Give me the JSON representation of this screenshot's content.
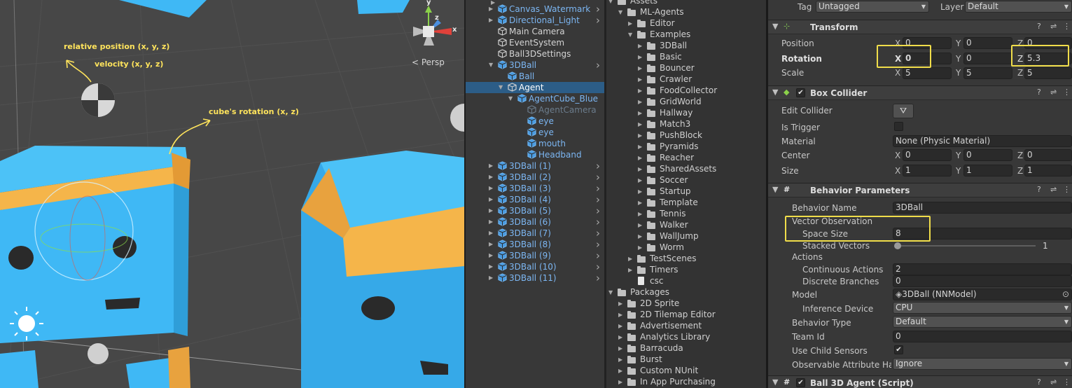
{
  "scene": {
    "annotations": {
      "relative_position": "relative position (x, y, z)",
      "velocity": "velocity (x, y, z)",
      "cube_rotation": "cube's rotation (x, z)"
    },
    "gizmo": {
      "y": "y",
      "z": "z",
      "x": "x"
    },
    "projection_label": "< Persp",
    "annotation_color": "#ffe45c",
    "cube_color": "#3fb8f5",
    "headband_color": "#f5b54a"
  },
  "hierarchy": {
    "items": [
      {
        "label": "Canvas_Watermark",
        "style": "blue"
      },
      {
        "label": "Directional_Light",
        "style": "blue"
      },
      {
        "label": "Main Camera",
        "style": "normal"
      },
      {
        "label": "EventSystem",
        "style": "normal"
      },
      {
        "label": "Ball3DSettings",
        "style": "normal"
      },
      {
        "label": "3DBall",
        "style": "blue"
      },
      {
        "label": "Ball",
        "style": "blue"
      },
      {
        "label": "Agent",
        "style": "normal"
      },
      {
        "label": "AgentCube_Blue",
        "style": "blue"
      },
      {
        "label": "AgentCamera",
        "style": "grey"
      },
      {
        "label": "eye",
        "style": "blue"
      },
      {
        "label": "eye",
        "style": "blue"
      },
      {
        "label": "mouth",
        "style": "blue"
      },
      {
        "label": "Headband",
        "style": "blue"
      },
      {
        "label": "3DBall (1)",
        "style": "blue"
      },
      {
        "label": "3DBall (2)",
        "style": "blue"
      },
      {
        "label": "3DBall (3)",
        "style": "blue"
      },
      {
        "label": "3DBall (4)",
        "style": "blue"
      },
      {
        "label": "3DBall (5)",
        "style": "blue"
      },
      {
        "label": "3DBall (6)",
        "style": "blue"
      },
      {
        "label": "3DBall (7)",
        "style": "blue"
      },
      {
        "label": "3DBall (8)",
        "style": "blue"
      },
      {
        "label": "3DBall (9)",
        "style": "blue"
      },
      {
        "label": "3DBall (10)",
        "style": "blue"
      },
      {
        "label": "3DBall (11)",
        "style": "blue"
      }
    ],
    "selected": "Agent"
  },
  "project": {
    "assets_label": "Assets",
    "ml_agents": "ML-Agents",
    "editor": "Editor",
    "examples": "Examples",
    "example_folders": [
      "3DBall",
      "Basic",
      "Bouncer",
      "Crawler",
      "FoodCollector",
      "GridWorld",
      "Hallway",
      "Match3",
      "PushBlock",
      "Pyramids",
      "Reacher",
      "SharedAssets",
      "Soccer",
      "Startup",
      "Template",
      "Tennis",
      "Walker",
      "WallJump",
      "Worm"
    ],
    "test_scenes": "TestScenes",
    "timers": "Timers",
    "csc": "csc",
    "packages_label": "Packages",
    "packages": [
      "2D Sprite",
      "2D Tilemap Editor",
      "Advertisement",
      "Analytics Library",
      "Barracuda",
      "Burst",
      "Custom NUnit",
      "In App Purchasing"
    ]
  },
  "inspector": {
    "tag_label": "Tag",
    "tag_value": "Untagged",
    "layer_label": "Layer",
    "layer_value": "Default",
    "transform": {
      "title": "Transform",
      "position": {
        "label": "Position",
        "x": "0",
        "y": "0",
        "z": "0"
      },
      "rotation": {
        "label": "Rotation",
        "x": "0",
        "y": "0",
        "z": "5.3"
      },
      "scale": {
        "label": "Scale",
        "x": "5",
        "y": "5",
        "z": "5"
      }
    },
    "box_collider": {
      "title": "Box Collider",
      "edit_collider": "Edit Collider",
      "is_trigger": "Is Trigger",
      "material_label": "Material",
      "material_value": "None (Physic Material)",
      "center": {
        "label": "Center",
        "x": "0",
        "y": "0",
        "z": "0"
      },
      "size": {
        "label": "Size",
        "x": "1",
        "y": "1",
        "z": "1"
      }
    },
    "behavior": {
      "title": "Behavior Parameters",
      "behavior_name_label": "Behavior Name",
      "behavior_name_value": "3DBall",
      "vector_observation": "Vector Observation",
      "space_size_label": "Space Size",
      "space_size_value": "8",
      "stacked_vectors_label": "Stacked Vectors",
      "stacked_vectors_value": "1",
      "actions": "Actions",
      "continuous_label": "Continuous Actions",
      "continuous_value": "2",
      "discrete_label": "Discrete Branches",
      "discrete_value": "0",
      "model_label": "Model",
      "model_value": "3DBall (NNModel)",
      "inference_label": "Inference Device",
      "inference_value": "CPU",
      "behavior_type_label": "Behavior Type",
      "behavior_type_value": "Default",
      "team_id_label": "Team Id",
      "team_id_value": "0",
      "child_sensors_label": "Use Child Sensors",
      "observable_label": "Observable Attribute Hand",
      "observable_value": "Ignore"
    },
    "agent_script": {
      "title": "Ball 3D Agent (Script)"
    },
    "highlight_color": "#f0dd4a"
  }
}
